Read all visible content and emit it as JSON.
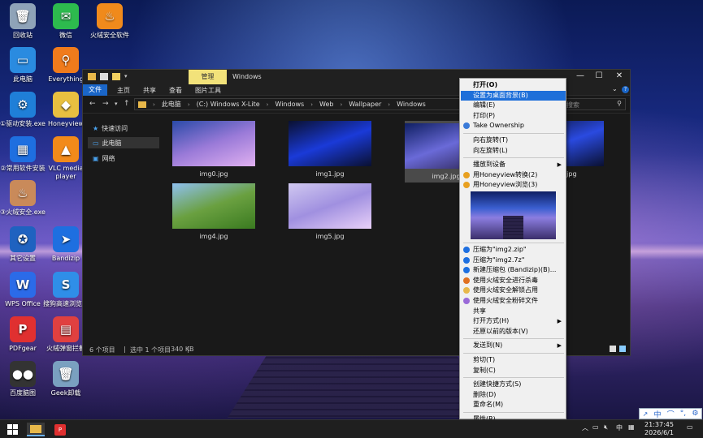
{
  "desktop": {
    "icons": [
      {
        "label": "回收站",
        "icon": "recycle-bin-icon",
        "color": "#8fa3b8",
        "glyph": "🗑"
      },
      {
        "label": "微信",
        "icon": "wechat-icon",
        "color": "#2dbb4e",
        "glyph": "✉"
      },
      {
        "label": "火绒安全软件",
        "icon": "huorong-icon",
        "color": "#f08a1c",
        "glyph": "♨"
      },
      {
        "label": "此电脑",
        "icon": "computer-icon",
        "color": "#2a8be0",
        "glyph": "▭"
      },
      {
        "label": "Everything",
        "icon": "everything-search-icon",
        "color": "#f07b1c",
        "glyph": "⚲"
      },
      {
        "label": "①驱动安装.exe",
        "icon": "driver-install-icon",
        "color": "#1f7fd8",
        "glyph": "⚙"
      },
      {
        "label": "Honeyview",
        "icon": "honeyview-icon",
        "color": "#e8c040",
        "glyph": "◆"
      },
      {
        "label": "②常用软件安装",
        "icon": "software-install-icon",
        "color": "#1e6fe0",
        "glyph": "▦"
      },
      {
        "label": "VLC media player",
        "icon": "vlc-icon",
        "color": "#f28a1a",
        "glyph": "▲"
      },
      {
        "label": "③火绒安全.exe",
        "icon": "huorong-exe-icon",
        "color": "#c98a5a",
        "glyph": "♨"
      },
      {
        "label": "其它设置",
        "icon": "settings-globe-icon",
        "color": "#1f62c0",
        "glyph": "✪"
      },
      {
        "label": "Bandizip",
        "icon": "bandizip-icon",
        "color": "#1e6fe0",
        "glyph": "➤"
      },
      {
        "label": "WPS Office",
        "icon": "wps-icon",
        "color": "#2b6be8",
        "glyph": "W"
      },
      {
        "label": "搜狗高速浏览器",
        "icon": "sogou-browser-icon",
        "color": "#2f8ee8",
        "glyph": "S"
      },
      {
        "label": "PDFgear",
        "icon": "pdfgear-icon",
        "color": "#e03030",
        "glyph": "P"
      },
      {
        "label": "火绒弹窗拦截",
        "icon": "popup-blocker-icon",
        "color": "#e04040",
        "glyph": "▤"
      },
      {
        "label": "百度脑图",
        "icon": "baidu-mindmap-icon",
        "color": "#333333",
        "glyph": "●●"
      },
      {
        "label": "Geek卸载",
        "icon": "geek-uninstaller-icon",
        "color": "#7aa0c0",
        "glyph": "🗑"
      }
    ]
  },
  "explorer": {
    "title": "Windows",
    "manage_tab": "管理",
    "ribbon_tabs": [
      "文件",
      "主页",
      "共享",
      "查看",
      "图片工具"
    ],
    "path": [
      "此电脑",
      "(C:) Windows X-Lite",
      "Windows",
      "Web",
      "Wallpaper",
      "Windows"
    ],
    "search_placeholder": "搜索",
    "nav": [
      {
        "label": "快速访问",
        "icon": "star-icon"
      },
      {
        "label": "此电脑",
        "icon": "computer-icon"
      },
      {
        "label": "网络",
        "icon": "network-icon"
      }
    ],
    "files": [
      {
        "name": "img0.jpg",
        "colors": [
          "#2a4aa8",
          "#9a7ad8",
          "#e0b0f0"
        ]
      },
      {
        "name": "img1.jpg",
        "colors": [
          "#0a1030",
          "#1a3ad8",
          "#0a1030"
        ]
      },
      {
        "name": "img2.jpg",
        "colors": [
          "#0f1f63",
          "#6a6ad8",
          "#2b2350"
        ]
      },
      {
        "name": "img3.jpg",
        "colors": [
          "#0a1030",
          "#2a4ae0",
          "#0a1030"
        ]
      },
      {
        "name": "img4.jpg",
        "colors": [
          "#8fc0f0",
          "#6aa040",
          "#3a7a20"
        ]
      },
      {
        "name": "img5.jpg",
        "colors": [
          "#d0c8f0",
          "#a090e0",
          "#e8d0f8"
        ]
      }
    ],
    "status": {
      "count": "6 个项目",
      "selected": "选中 1 个项目",
      "size": "340 KB"
    }
  },
  "context_menu": {
    "items": [
      {
        "label": "打开(O)",
        "bold": true
      },
      {
        "label": "设置为桌面背景(B)",
        "highlight": true
      },
      {
        "label": "编辑(E)"
      },
      {
        "label": "打印(P)"
      },
      {
        "label": "Take Ownership",
        "icon": "shield-icon"
      },
      {
        "sep": true
      },
      {
        "label": "向右旋转(T)"
      },
      {
        "label": "向左旋转(L)"
      },
      {
        "sep": true
      },
      {
        "label": "播放到设备",
        "submenu": true
      },
      {
        "label": "用Honeyview转换(2)",
        "icon": "honeyview-icon"
      },
      {
        "label": "用Honeyview浏览(3)",
        "icon": "honeyview-icon"
      },
      {
        "preview": true
      },
      {
        "sep": true
      },
      {
        "label": "压缩为\"img2.zip\"",
        "icon": "bandizip-icon"
      },
      {
        "label": "压缩为\"img2.7z\"",
        "icon": "bandizip-icon"
      },
      {
        "label": "新建压缩包 (Bandizip)(B)...",
        "icon": "bandizip-icon"
      },
      {
        "label": "使用火绒安全进行杀毒",
        "icon": "huorong-icon"
      },
      {
        "label": "使用火绒安全解锁占用",
        "icon": "folder-lock-icon"
      },
      {
        "label": "使用火绒安全粉碎文件",
        "icon": "shredder-icon"
      },
      {
        "label": "共享"
      },
      {
        "label": "打开方式(H)",
        "submenu": true
      },
      {
        "label": "还原以前的版本(V)"
      },
      {
        "sep": true
      },
      {
        "label": "发送到(N)",
        "submenu": true
      },
      {
        "sep": true
      },
      {
        "label": "剪切(T)"
      },
      {
        "label": "复制(C)"
      },
      {
        "sep": true
      },
      {
        "label": "创建快捷方式(S)"
      },
      {
        "label": "删除(D)"
      },
      {
        "label": "重命名(M)"
      },
      {
        "sep": true
      },
      {
        "label": "属性(R)"
      }
    ]
  },
  "taskbar": {
    "ime": "中",
    "time": "21:37:45",
    "date": "2026/6/1"
  },
  "ime_toolbar": [
    "中",
    "⌒",
    "°,",
    "⚙"
  ]
}
